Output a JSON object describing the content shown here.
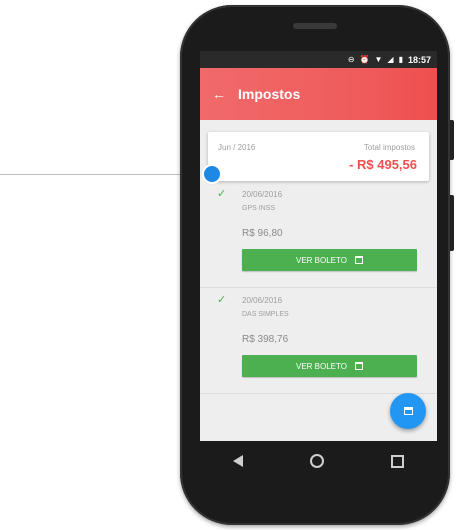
{
  "status_bar": {
    "time": "18:57"
  },
  "app_bar": {
    "title": "Impostos"
  },
  "summary": {
    "month": "Jun / 2016",
    "total_label": "Total impostos",
    "total_value": "- R$ 495,56"
  },
  "items": [
    {
      "date": "20/06/2016",
      "name": "GPS INSS",
      "amount": "R$ 96,80",
      "button_label": "VER BOLETO"
    },
    {
      "date": "20/06/2016",
      "name": "DAS SIMPLES",
      "amount": "R$ 398,76",
      "button_label": "VER BOLETO"
    }
  ],
  "colors": {
    "app_bar": "#ef5b5b",
    "total_value": "#ef4f4f",
    "button": "#4caf50",
    "fab": "#2196f3",
    "callout_dot": "#1e88e5"
  },
  "icons": [
    "minus-circle-icon",
    "alarm-icon",
    "wifi-icon",
    "signal-icon",
    "battery-icon",
    "back-arrow-icon",
    "check-icon",
    "calendar-icon",
    "nav-back-icon",
    "nav-home-icon",
    "nav-recent-icon"
  ]
}
